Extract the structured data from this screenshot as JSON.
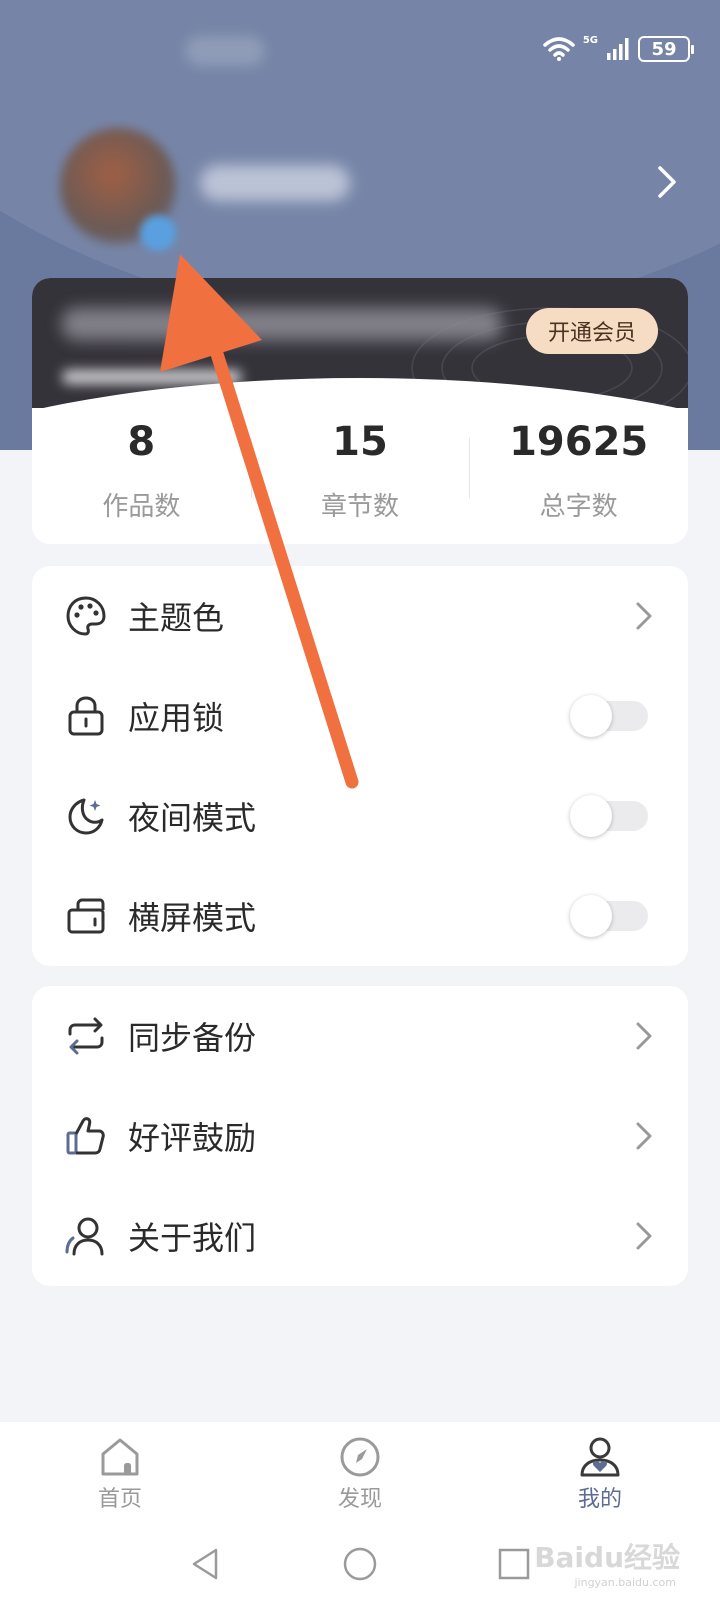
{
  "status_bar": {
    "network": "5G",
    "battery": "59"
  },
  "profile": {
    "chevron_icon": "chevron-right-icon"
  },
  "vip": {
    "button_label": "开通会员"
  },
  "stats": [
    {
      "value": "8",
      "label": "作品数"
    },
    {
      "value": "15",
      "label": "章节数"
    },
    {
      "value": "19625",
      "label": "总字数"
    }
  ],
  "settings": {
    "items": [
      {
        "label": "主题色",
        "icon": "palette-icon",
        "control": "chevron"
      },
      {
        "label": "应用锁",
        "icon": "lock-icon",
        "control": "toggle",
        "on": false
      },
      {
        "label": "夜间模式",
        "icon": "moon-icon",
        "control": "toggle",
        "on": false
      },
      {
        "label": "横屏模式",
        "icon": "landscape-icon",
        "control": "toggle",
        "on": false
      }
    ]
  },
  "more": {
    "items": [
      {
        "label": "同步备份",
        "icon": "sync-icon"
      },
      {
        "label": "好评鼓励",
        "icon": "thumbs-up-icon"
      },
      {
        "label": "关于我们",
        "icon": "user-icon"
      }
    ]
  },
  "bottom_nav": {
    "items": [
      {
        "label": "首页",
        "icon": "home-icon",
        "active": false
      },
      {
        "label": "发现",
        "icon": "compass-icon",
        "active": false
      },
      {
        "label": "我的",
        "icon": "profile-icon",
        "active": true
      }
    ]
  },
  "watermark": {
    "text": "Baidu经验",
    "sub": "jingyan.baidu.com"
  },
  "colors": {
    "header": "#6a7a9e",
    "accent": "#5d6c92",
    "arrow": "#f07040",
    "vip_button": "#f6dcc2"
  }
}
